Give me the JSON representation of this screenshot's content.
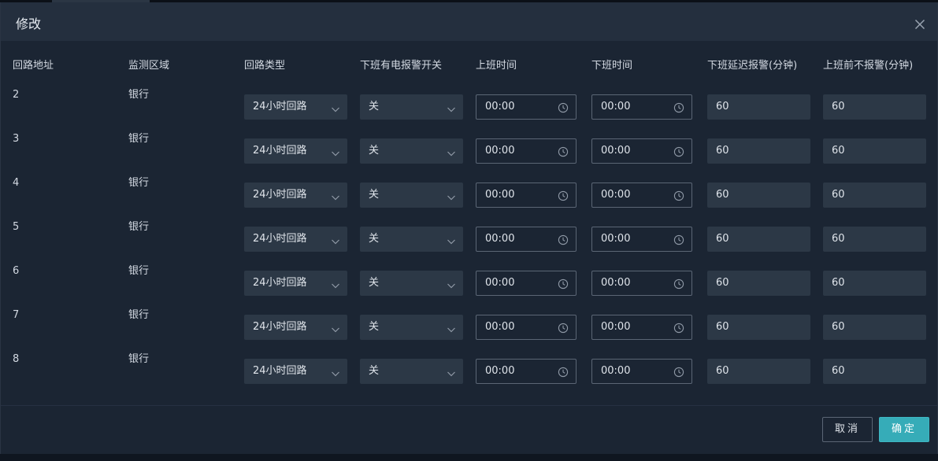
{
  "dialog": {
    "title": "修改"
  },
  "columns": [
    "回路地址",
    "监测区域",
    "回路类型",
    "下班有电报警开关",
    "上班时间",
    "下班时间",
    "下班延迟报警(分钟)",
    "上班前不报警(分钟)"
  ],
  "rows": [
    {
      "address": "2",
      "area": "银行",
      "loop_type": "24小时回路",
      "alarm_switch": "关",
      "work_start": "00:00",
      "work_end": "00:00",
      "delay_alarm": "60",
      "no_alarm_before": "60"
    },
    {
      "address": "3",
      "area": "银行",
      "loop_type": "24小时回路",
      "alarm_switch": "关",
      "work_start": "00:00",
      "work_end": "00:00",
      "delay_alarm": "60",
      "no_alarm_before": "60"
    },
    {
      "address": "4",
      "area": "银行",
      "loop_type": "24小时回路",
      "alarm_switch": "关",
      "work_start": "00:00",
      "work_end": "00:00",
      "delay_alarm": "60",
      "no_alarm_before": "60"
    },
    {
      "address": "5",
      "area": "银行",
      "loop_type": "24小时回路",
      "alarm_switch": "关",
      "work_start": "00:00",
      "work_end": "00:00",
      "delay_alarm": "60",
      "no_alarm_before": "60"
    },
    {
      "address": "6",
      "area": "银行",
      "loop_type": "24小时回路",
      "alarm_switch": "关",
      "work_start": "00:00",
      "work_end": "00:00",
      "delay_alarm": "60",
      "no_alarm_before": "60"
    },
    {
      "address": "7",
      "area": "银行",
      "loop_type": "24小时回路",
      "alarm_switch": "关",
      "work_start": "00:00",
      "work_end": "00:00",
      "delay_alarm": "60",
      "no_alarm_before": "60"
    },
    {
      "address": "8",
      "area": "银行",
      "loop_type": "24小时回路",
      "alarm_switch": "关",
      "work_start": "00:00",
      "work_end": "00:00",
      "delay_alarm": "60",
      "no_alarm_before": "60"
    }
  ],
  "footer": {
    "cancel_label": "取消",
    "ok_label": "确定"
  },
  "icons": {
    "close": "close-icon",
    "select_arrow": "chevron-down-icon",
    "time": "clock-icon"
  },
  "colors": {
    "background": "#1b2533",
    "header": "#242f3e",
    "field": "#2c3846",
    "accent": "#36acb8"
  }
}
